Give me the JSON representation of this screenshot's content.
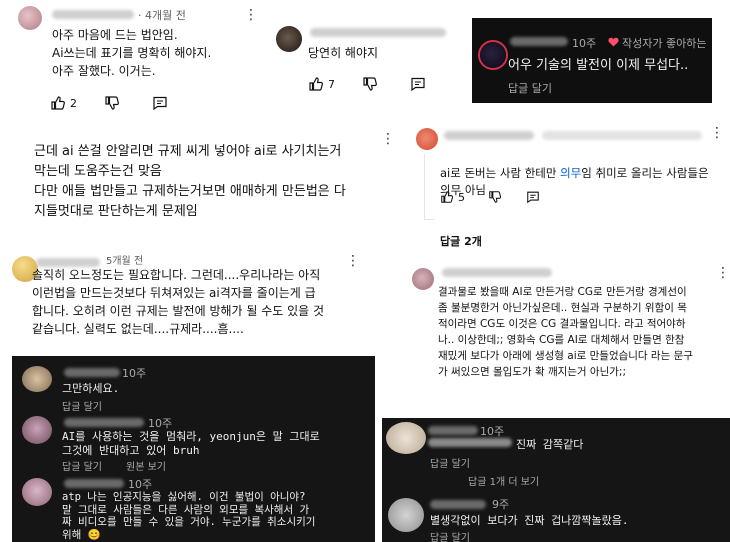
{
  "c1": {
    "time": "· 4개월 전",
    "text": "아주 마음에 드는 법안임.\nAi쓰는데 표기를 명확히 해야지.\n아주 잘했다. 이거는.",
    "likes": "2"
  },
  "c2": {
    "text": "당연히 해야지",
    "likes": "7"
  },
  "c3": {
    "time": "10주",
    "heart_label": "작성자가 좋아하는",
    "text": "어우 기술의 발전이 이제 무섭다..",
    "reply": "답글 달기"
  },
  "c4": {
    "text": "근데 ai 쓴걸 안알리면 규제 씨게 넣어야 ai로 사기치는거\n막는데 도움주는건 맞음\n다만 애들 법만들고 규제하는거보면 애매하게 만든법은 다\n지들멋대로 판단하는게 문제임"
  },
  "c5": {
    "text_pre": "ai로 돈버는 사람 한테만 ",
    "text_link": "의무",
    "text_post": "임 취미로 올리는 사람들은\n의무 아님",
    "likes": "5",
    "replies": "답글 2개"
  },
  "c6": {
    "time": "5개월 전",
    "text": "솔직히 오느정도는 필요합니다. 그런데....우리나라는 아직\n이런법을 만드는것보다 뒤쳐져있는 ai격자를 줄이는게 급\n합니다. 오히려 이런 규제는 발전에 방해가 될 수도 있을 것\n같습니다. 실력도 없는데....규제라....흠...."
  },
  "c7": {
    "text": "결과물로 봤을때 AI로 만든거랑 CG로 만든거랑 경계선이\n좀 불분명한거 아닌가싶은데.. 현실과 구분하기 위함이 목\n적이라면 CG도 이것은 CG 결과물입니다. 라고 적어야하\n나.. 이상한데;; 영화속 CG를 AI로 대체해서 만들면 한참\n재밌게 보다가 아래에 생성형 ai로 만들었습니다 라는 문구\n가 써있으면 몰입도가 확 깨지는거 아닌가;;"
  },
  "c8": {
    "time": "10주",
    "text": "그만하세요.",
    "reply": "답글 달기"
  },
  "c9": {
    "time": "10주",
    "text": "AI를 사용하는 것을 멈춰라, yeonjun은 말 그대로\n그것에 반대하고 있어 bruh",
    "reply": "답글 달기",
    "original": "원본 보기"
  },
  "c10": {
    "time": "10주",
    "text": "atp 나는 인공지능을 싫어해. 이건 불법이 아니야?\n말 그대로 사람들은 다른 사람의 외모를 복사해서 가\n짜 비디오를 만들 수 있을 거야. 누군가를 취소시키기\n위해 😊"
  },
  "c11": {
    "time": "10주",
    "text": "진짜 감쪽같다",
    "reply": "답글 달기",
    "more_replies": "답글 1개 더 보기"
  },
  "c12": {
    "time": "9주",
    "text": "별생각없이 보다가 진짜 겁나깜짝놀랐음.",
    "reply": "답글 달기"
  }
}
